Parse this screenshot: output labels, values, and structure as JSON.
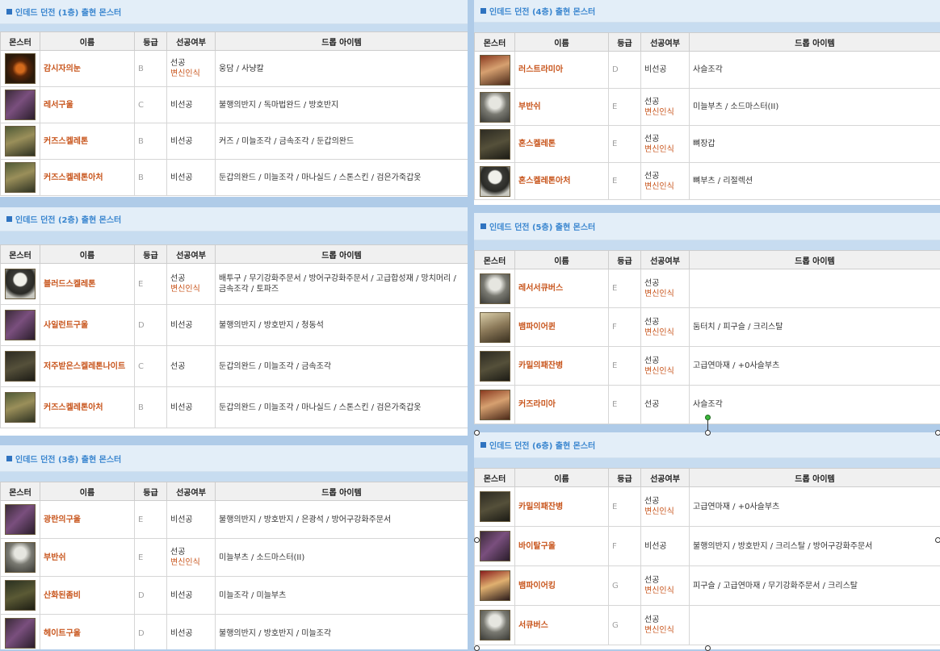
{
  "headers": {
    "monster": "몬스터",
    "name": "이름",
    "grade": "등급",
    "aggressive": "선공여부",
    "drops": "드롭 아이템"
  },
  "sections": [
    {
      "title": "인데드 던전 (1층) 출현 몬스터",
      "rows": [
        {
          "icon": "eye-monster-icon",
          "name": "감시자의눈",
          "grade": "B",
          "aggro": "선공",
          "aggro2": "변신인식",
          "drops": "웅담 / 사냥칼"
        },
        {
          "icon": "ghoul-icon",
          "name": "레서구울",
          "grade": "C",
          "aggro": "비선공",
          "aggro2": "",
          "drops": "불행의반지 / 독마법완드 / 방호반지"
        },
        {
          "icon": "skeleton-icon",
          "name": "커즈스켈레톤",
          "grade": "B",
          "aggro": "비선공",
          "aggro2": "",
          "drops": "커즈 / 미늘조각 / 금속조각 / 둔갑의완드"
        },
        {
          "icon": "skeleton-archer-icon",
          "name": "커즈스켈레톤아처",
          "grade": "B",
          "aggro": "비선공",
          "aggro2": "",
          "drops": "둔갑의완드 / 미늘조각 / 마나실드 / 스톤스킨 / 검은가죽갑옷"
        }
      ]
    },
    {
      "title": "인데드 던전 (2층) 출현 몬스터",
      "rows": [
        {
          "icon": "skull-skeleton-icon",
          "name": "블러드스켈레톤",
          "grade": "E",
          "aggro": "선공",
          "aggro2": "변신인식",
          "drops": "배투구 / 무기강화주문서 / 방어구강화주문서 / 고급합성재 / 망치머리 / 금속조각 / 토파즈"
        },
        {
          "icon": "ghoul-icon",
          "name": "사일런트구울",
          "grade": "D",
          "aggro": "비선공",
          "aggro2": "",
          "drops": "불행의반지 / 방호반지 / 청동석"
        },
        {
          "icon": "cursed-skeleton-knight-icon",
          "name": "저주받은스켈레톤나이트",
          "grade": "C",
          "aggro": "선공",
          "aggro2": "",
          "drops": "둔갑의완드 / 미늘조각 / 금속조각"
        },
        {
          "icon": "skeleton-archer-icon",
          "name": "커즈스켈레톤아처",
          "grade": "B",
          "aggro": "비선공",
          "aggro2": "",
          "drops": "둔갑의완드 / 미늘조각 / 마나실드 / 스톤스킨 / 검은가죽갑옷"
        }
      ]
    },
    {
      "title": "인데드 던전 (3층) 출현 몬스터",
      "rows": [
        {
          "icon": "ghoul-icon",
          "name": "광란의구울",
          "grade": "E",
          "aggro": "비선공",
          "aggro2": "",
          "drops": "불행의반지 / 방호반지 / 은광석 / 방어구강화주문서"
        },
        {
          "icon": "banshee-icon",
          "name": "부반쉬",
          "grade": "E",
          "aggro": "선공",
          "aggro2": "변신인식",
          "drops": "미늘부츠 / 소드마스터(II)"
        },
        {
          "icon": "zombie-icon",
          "name": "산화된좀비",
          "grade": "D",
          "aggro": "비선공",
          "aggro2": "",
          "drops": "미늘조각 / 미늘부츠"
        },
        {
          "icon": "ghoul-icon",
          "name": "헤이트구울",
          "grade": "D",
          "aggro": "비선공",
          "aggro2": "",
          "drops": "불행의반지 / 방호반지 / 미늘조각"
        }
      ]
    },
    {
      "title": "인데드 던전 (4층) 출현 몬스터",
      "rows": [
        {
          "icon": "lamia-icon",
          "name": "러스트라미아",
          "grade": "D",
          "aggro": "비선공",
          "aggro2": "",
          "drops": "사슬조각"
        },
        {
          "icon": "banshee-icon",
          "name": "부반쉬",
          "grade": "E",
          "aggro": "선공",
          "aggro2": "변신인식",
          "drops": "미늘부츠 / 소드마스터(II)"
        },
        {
          "icon": "dark-skeleton-icon",
          "name": "혼스켈레톤",
          "grade": "E",
          "aggro": "선공",
          "aggro2": "변신인식",
          "drops": "뼈장갑"
        },
        {
          "icon": "skull-skeleton-icon",
          "name": "혼스켈레톤아처",
          "grade": "E",
          "aggro": "선공",
          "aggro2": "변신인식",
          "drops": "뼈부츠 / 리절렉션"
        }
      ]
    },
    {
      "title": "인데드 던전 (5층) 출현 몬스터",
      "rows": [
        {
          "icon": "succubus-icon",
          "name": "레서서큐버스",
          "grade": "E",
          "aggro": "선공",
          "aggro2": "변신인식",
          "drops": ""
        },
        {
          "icon": "vampire-queen-icon",
          "name": "뱀파이어퀸",
          "grade": "F",
          "aggro": "선공",
          "aggro2": "변신인식",
          "drops": "둠터치 / 피구슬 / 크리스탈"
        },
        {
          "icon": "karma-remnant-icon",
          "name": "카밀의패잔병",
          "grade": "E",
          "aggro": "선공",
          "aggro2": "변신인식",
          "drops": "고급연마재 / +0사슬부츠"
        },
        {
          "icon": "lamia-icon",
          "name": "커즈라미아",
          "grade": "E",
          "aggro": "선공",
          "aggro2": "",
          "drops": "사슬조각"
        }
      ]
    },
    {
      "title": "인데드 던전 (6층) 출현 몬스터",
      "rows": [
        {
          "icon": "karma-remnant-icon",
          "name": "카밀의패잔병",
          "grade": "E",
          "aggro": "선공",
          "aggro2": "변신인식",
          "drops": "고급연마재 / +0사슬부츠"
        },
        {
          "icon": "ghoul-icon",
          "name": "바이탈구울",
          "grade": "F",
          "aggro": "비선공",
          "aggro2": "",
          "drops": "불행의반지 / 방호반지 / 크리스탈 / 방어구강화주문서"
        },
        {
          "icon": "vampire-king-icon",
          "name": "뱀파이어킹",
          "grade": "G",
          "aggro": "선공",
          "aggro2": "변신인식",
          "drops": "피구슬 / 고급연마재 / 무기강화주문서 / 크리스탈"
        },
        {
          "icon": "succubus-icon",
          "name": "서큐버스",
          "grade": "G",
          "aggro": "선공",
          "aggro2": "변신인식",
          "drops": ""
        }
      ]
    }
  ]
}
